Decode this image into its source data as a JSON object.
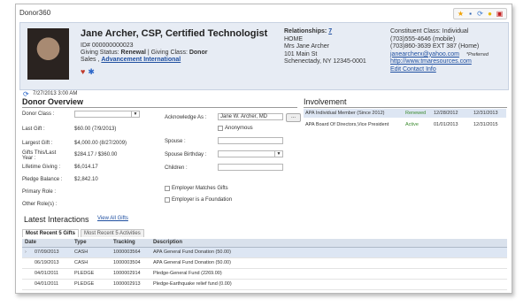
{
  "app": {
    "title": "Donor360"
  },
  "toolbar": {
    "icons": [
      "star-icon",
      "save-icon",
      "refresh-icon",
      "lightbulb-icon",
      "pdf-icon"
    ]
  },
  "header": {
    "name": "Jane Archer, CSP, Certified Technologist",
    "id_line": "ID# 000000000023",
    "giving_status_label": "Giving Status:",
    "giving_status": "Renewal",
    "giving_class_label": "| Giving Class:",
    "giving_class": "Donor",
    "sales_prefix": "Sales ,",
    "org_link": "Advancement International",
    "relationships_label": "Relationships:",
    "relationships_count": "7",
    "address": [
      "HOME",
      "Mrs Jane Archer",
      "101 Main St",
      "Schenectady, NY   12345-0001"
    ],
    "constituent_class": "Constituent Class: Individual",
    "phone_mobile": "(703)555-4646 (mobile)",
    "phone_home": "(703)860-3639 EXT 387 (Home)",
    "email": "janearcherx@yahoo.com",
    "email_note": "*Preferred",
    "website": "http://www.tmaresources.com",
    "edit_contact": "Edit Contact Info"
  },
  "timestamp": "7/27/2013 3:00 AM",
  "overview": {
    "title": "Donor Overview",
    "fields": {
      "donor_class": {
        "label": "Donor Class :",
        "value": ""
      },
      "last_gift": {
        "label": "Last Gift :",
        "value": "$60.00 (7/9/2013)"
      },
      "largest_gift": {
        "label": "Largest Gift :",
        "value": "$4,000.00 (8/27/2009)"
      },
      "gifts_this_last": {
        "label1": "Gifts This/Last",
        "label2": "Year :",
        "value": "$284.17 / $360.00"
      },
      "lifetime_giving": {
        "label": "Lifetime Giving :",
        "value": "$6,014.17"
      },
      "pledge_balance": {
        "label": "Pledge Balance :",
        "value": "$2,842.10"
      },
      "primary_role": {
        "label": "Primary Role :",
        "value": ""
      },
      "other_roles": {
        "label": "Other Role(s) :",
        "value": ""
      },
      "acknowledge_as": {
        "label": "Acknowledge As :",
        "value": "Jane W. Archer, MD"
      },
      "anonymous": {
        "label": "Anonymous"
      },
      "spouse": {
        "label": "Spouse :",
        "value": ""
      },
      "spouse_birthday": {
        "label": "Spouse Birthday :",
        "value": ""
      },
      "children": {
        "label": "Children :",
        "value": ""
      },
      "employer_matches": {
        "label": "Employer Matches Gifts"
      },
      "employer_foundation": {
        "label": "Employer is a Foundation"
      }
    }
  },
  "involvement": {
    "title": "Involvement",
    "rows": [
      {
        "name": "APA Individual Member (Since 2012)",
        "status": "Renewed",
        "start": "12/28/2012",
        "end": "12/31/2013"
      },
      {
        "name": "APA Board Of Directors,Vice President",
        "status": "Active",
        "start": "01/01/2013",
        "end": "12/31/2015"
      }
    ]
  },
  "interactions": {
    "title": "Latest Interactions",
    "view_all": "View All Gifts",
    "tabs": [
      "Most Recent 5 Gifts",
      "Most Recent 5 Activities"
    ],
    "columns": [
      "Date",
      "Type",
      "Tracking",
      "Description"
    ],
    "rows": [
      {
        "date": "07/09/2013",
        "type": "CASH",
        "tracking": "1000003564",
        "desc": "APA General Fund Donation (50.00)"
      },
      {
        "date": "06/19/2013",
        "type": "CASH",
        "tracking": "1000003504",
        "desc": "APA General Fund Donation (50.00)"
      },
      {
        "date": "04/01/2011",
        "type": "PLEDGE",
        "tracking": "1000002914",
        "desc": "Pledge-General Fund (2269.00)"
      },
      {
        "date": "04/01/2011",
        "type": "PLEDGE",
        "tracking": "1000002913",
        "desc": "Pledge-Earthquake relief fund (0.00)"
      }
    ]
  }
}
